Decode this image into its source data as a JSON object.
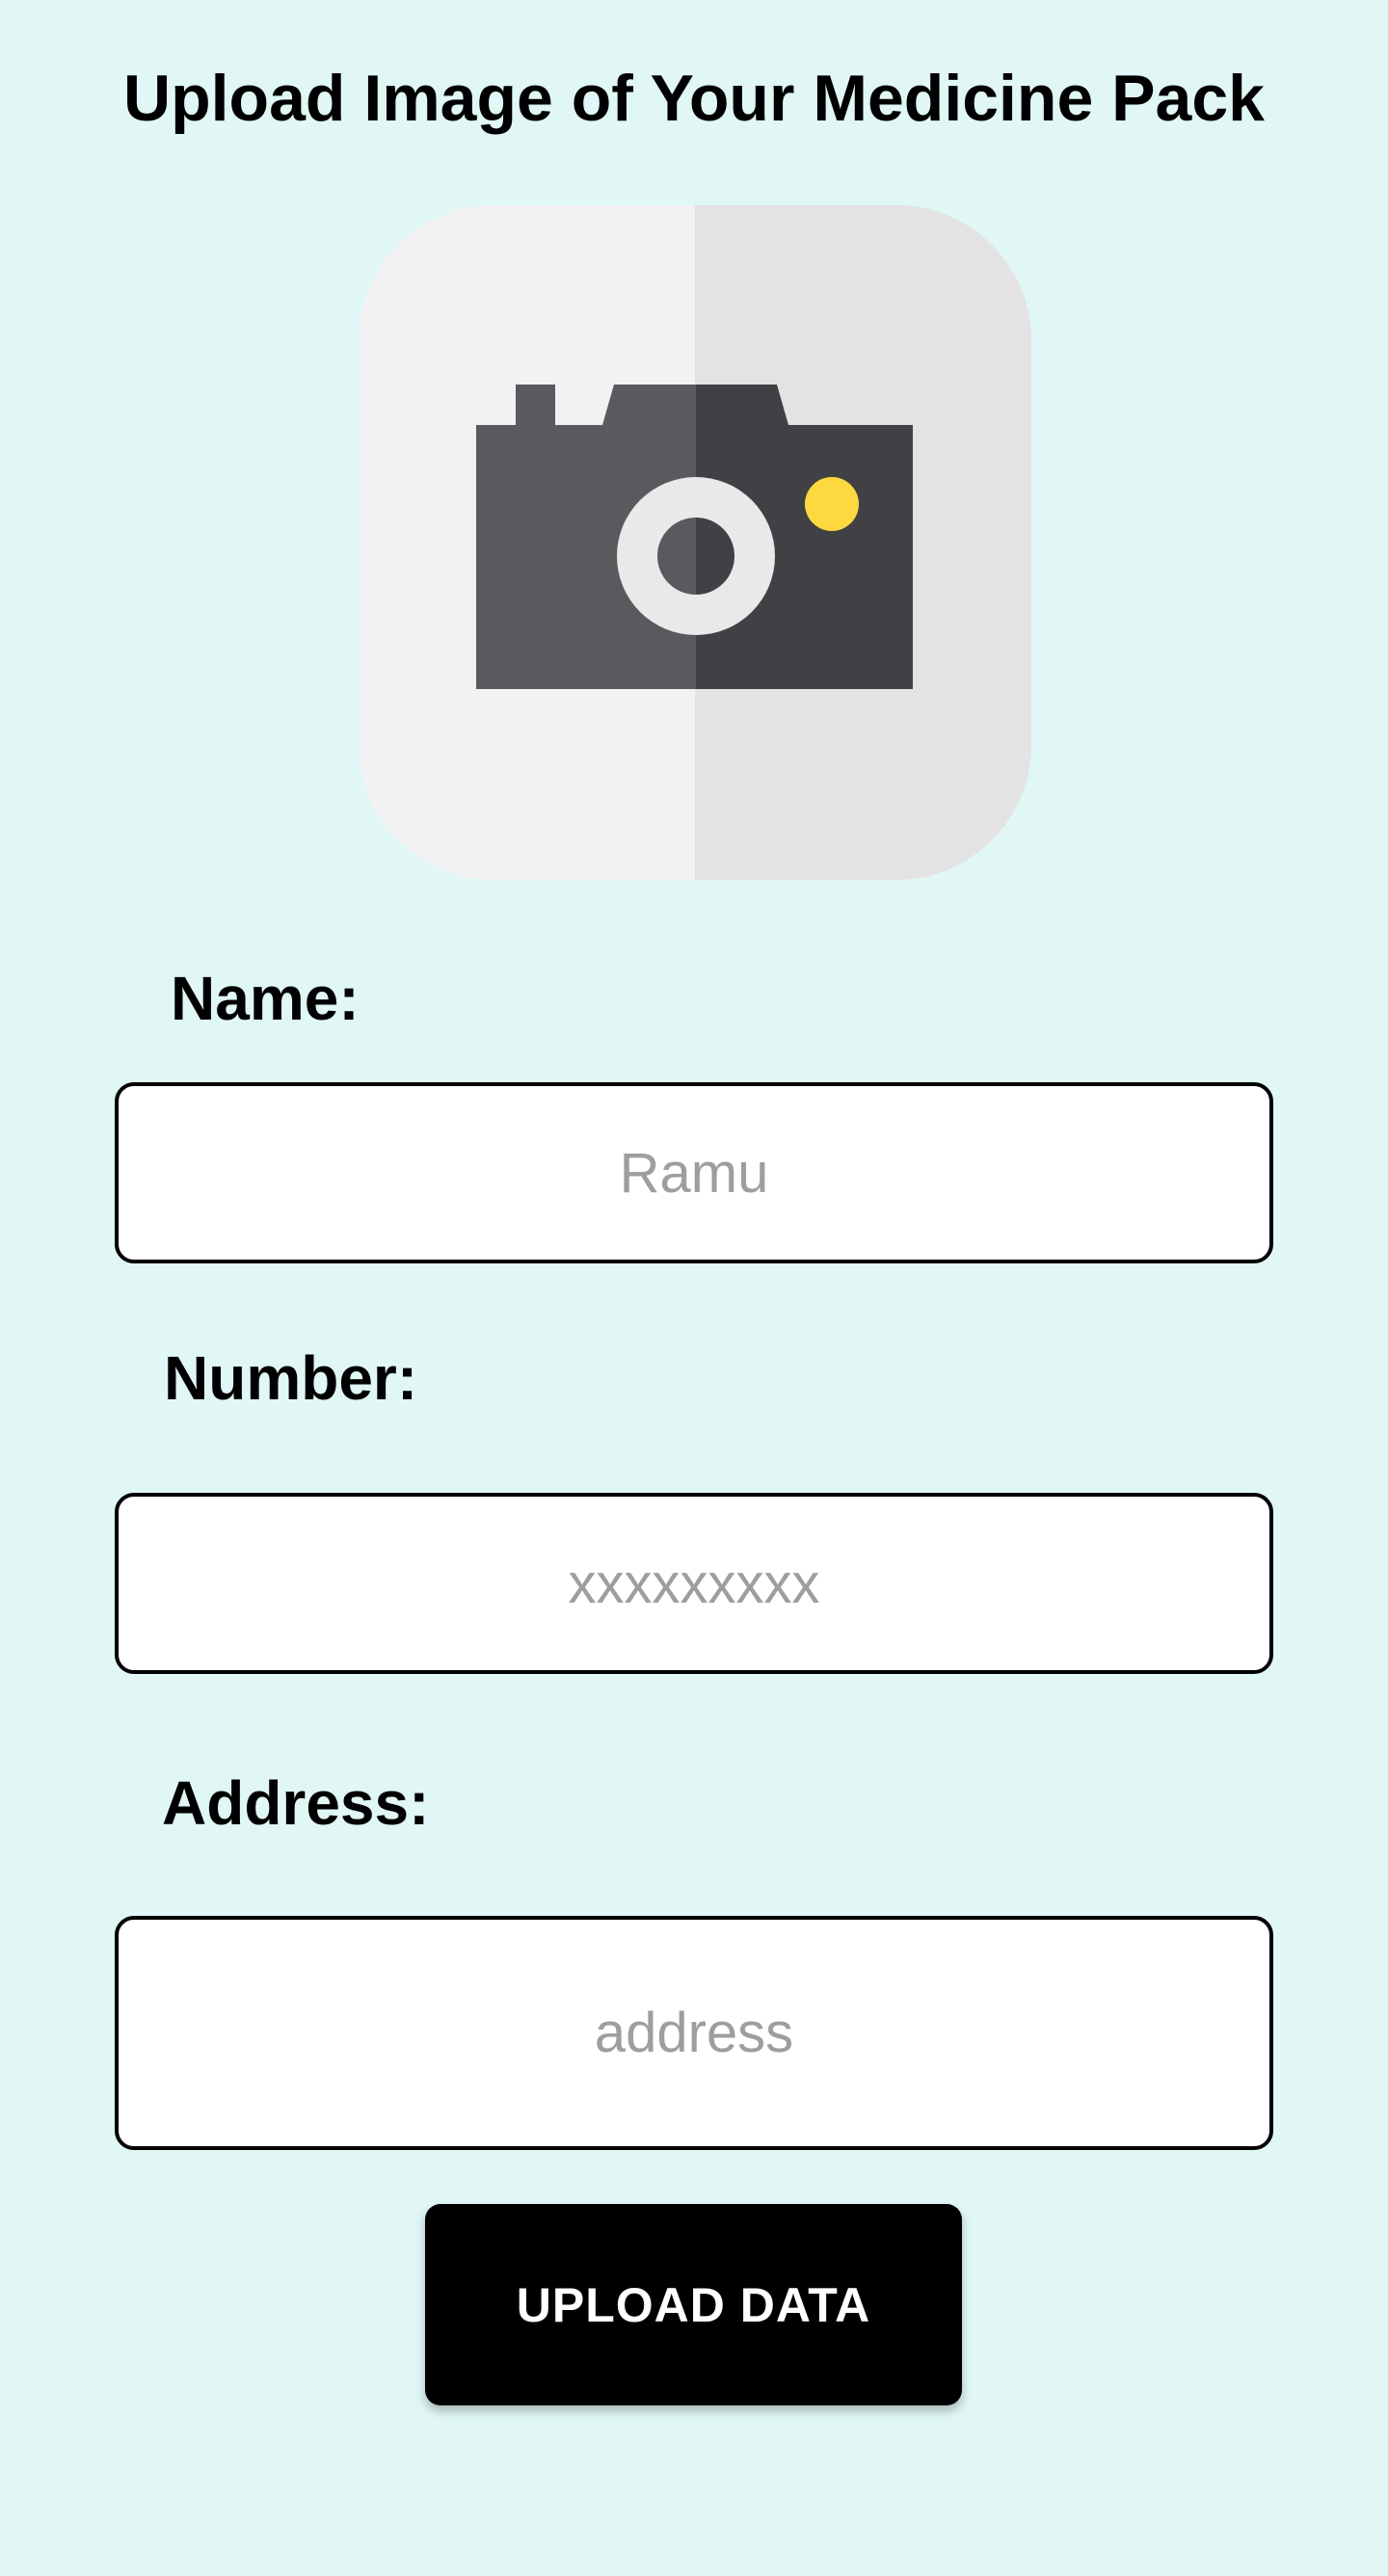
{
  "page": {
    "title": "Upload Image of Your Medicine Pack",
    "background_color": "#e0f7f5"
  },
  "camera_picker": {
    "icon": "camera-icon",
    "tile_colors": [
      "#f2f2f2",
      "#e3e3e3"
    ],
    "body_colors": [
      "#5a595e",
      "#414045"
    ],
    "flash_color": "#fdd83f"
  },
  "form": {
    "name": {
      "label": "Name:",
      "placeholder": "Ramu",
      "value": ""
    },
    "number": {
      "label": "Number:",
      "placeholder": "xxxxxxxxx",
      "value": ""
    },
    "address": {
      "label": "Address:",
      "placeholder": "address",
      "value": ""
    }
  },
  "actions": {
    "upload_label": "UPLOAD DATA"
  }
}
